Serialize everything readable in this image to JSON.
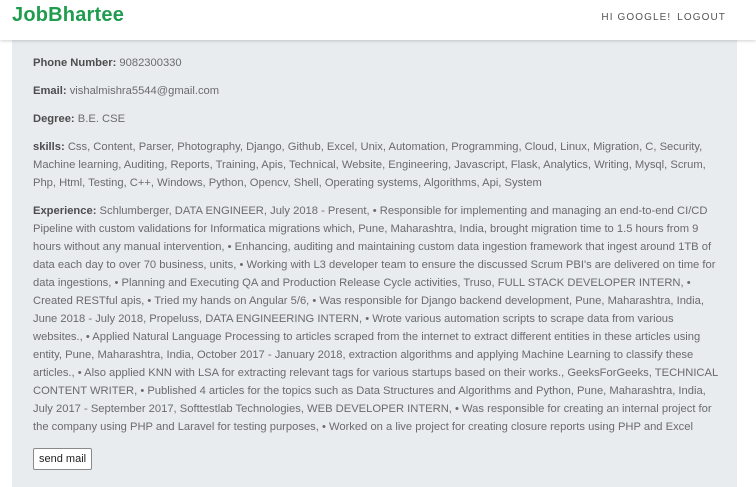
{
  "header": {
    "brand": "JobBhartee",
    "greeting": "HI GOOGLE!",
    "logout_label": "LOGOUT",
    "brand_color": "#1f9c4e"
  },
  "profile": {
    "phone": {
      "label": "Phone Number:",
      "value": "9082300330"
    },
    "email": {
      "label": "Email:",
      "value": "vishalmishra5544@gmail.com"
    },
    "degree": {
      "label": "Degree:",
      "value": "B.E. CSE"
    },
    "skills": {
      "label": "skills:",
      "value": "Css, Content, Parser, Photography, Django, Github, Excel, Unix, Automation, Programming, Cloud, Linux, Migration, C, Security, Machine learning, Auditing, Reports, Training, Apis, Technical, Website, Engineering, Javascript, Flask, Analytics, Writing, Mysql, Scrum, Php, Html, Testing, C++, Windows, Python, Opencv, Shell, Operating systems, Algorithms, Api, System"
    },
    "experience": {
      "label": "Experience:",
      "value": "Schlumberger, DATA ENGINEER, July 2018 - Present, • Responsible for implementing and managing an end-to-end CI/CD Pipeline with custom validations for Informatica migrations which, Pune, Maharashtra, India, brought migration time to 1.5 hours from 9 hours without any manual intervention, • Enhancing, auditing and maintaining custom data ingestion framework that ingest around 1TB of data each day to over 70 business, units, • Working with L3 developer team to ensure the discussed Scrum PBI's are delivered on time for data ingestions, • Planning and Executing QA and Production Release Cycle activities, Truso, FULL STACK DEVELOPER INTERN, • Created RESTful apis, • Tried my hands on Angular 5/6, • Was responsible for Django backend development, Pune, Maharashtra, India, June 2018 - July 2018, Propeluss, DATA ENGINEERING INTERN, • Wrote various automation scripts to scrape data from various websites., • Applied Natural Language Processing to articles scraped from the internet to extract different entities in these articles using entity, Pune, Maharashtra, India, October 2017 - January 2018, extraction algorithms and applying Machine Learning to classify these articles., • Also applied KNN with LSA for extracting relevant tags for various startups based on their works., GeeksForGeeks, TECHNICAL CONTENT WRITER, • Published 4 articles for the topics such as Data Structures and Algorithms and Python, Pune, Maharashtra, India, July 2017 - September 2017, Softtestlab Technologies, WEB DEVELOPER INTERN, • Was responsible for creating an internal project for the company using PHP and Laravel for testing purposes, • Worked on a live project for creating closure reports using PHP and Excel"
    }
  },
  "actions": {
    "send_mail_label": "send mail"
  }
}
